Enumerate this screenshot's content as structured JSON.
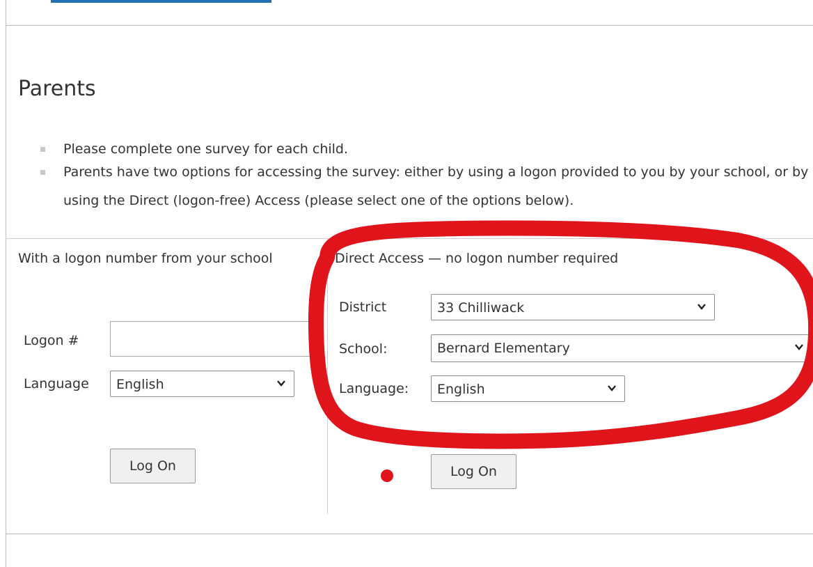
{
  "section_title": "Parents",
  "instructions": [
    "Please complete one survey for each child.",
    "Parents have two options for accessing the survey: either by using a logon provided to you by your school, or by using the Direct (logon-free) Access (please select one of the options below)."
  ],
  "logon_panel": {
    "heading": "With a logon number from your school",
    "logon_label": "Logon #",
    "logon_value": "",
    "language_label": "Language",
    "language_selected": "English",
    "submit_label": "Log On"
  },
  "direct_panel": {
    "heading": "Direct Access — no logon number required",
    "district_label": "District",
    "district_selected": "33 Chilliwack",
    "school_label": "School:",
    "school_selected": "Bernard Elementary",
    "language_label": "Language:",
    "language_selected": "English",
    "submit_label": "Log On"
  },
  "annotation": {
    "color": "#e0141b"
  },
  "colors": {
    "tab_accent": "#1f6fb5",
    "button_bg": "#f0f0f0"
  }
}
